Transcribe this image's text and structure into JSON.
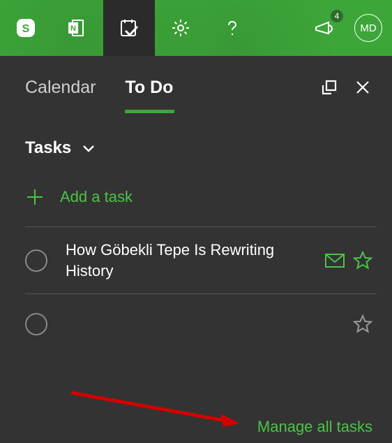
{
  "header": {
    "skype_icon": "skype",
    "onenote_icon": "onenote",
    "todo_icon": "todo",
    "settings_icon": "gear",
    "help_icon": "question",
    "announce_icon": "megaphone",
    "badge_count": "4",
    "avatar_initials": "MD"
  },
  "panel": {
    "tabs": {
      "calendar": "Calendar",
      "todo": "To Do"
    },
    "list_title": "Tasks",
    "add_task_label": "Add a task",
    "tasks": [
      {
        "title": "How Göbekli Tepe Is Rewriting History",
        "has_mail": true
      },
      {
        "title": "",
        "has_mail": false
      }
    ],
    "manage_link": "Manage all tasks"
  },
  "colors": {
    "accent": "#49c546",
    "header": "#3da639",
    "panel_bg": "#333333"
  }
}
